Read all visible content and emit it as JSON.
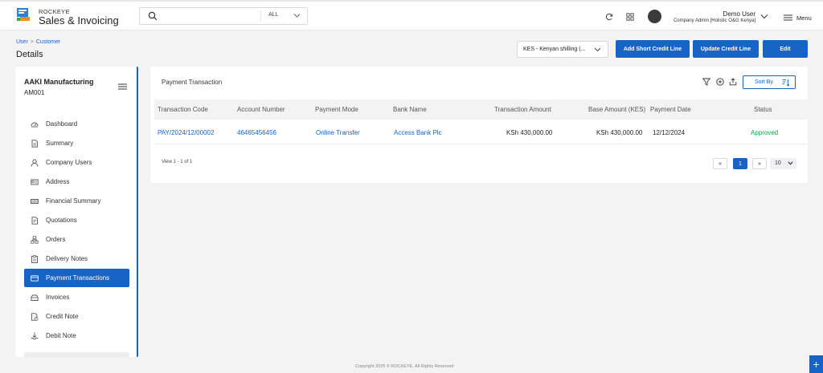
{
  "app": {
    "brand_small": "ROCKEYE",
    "brand_name": "Sales & Invoicing"
  },
  "search": {
    "value": "",
    "filter": "ALL"
  },
  "user": {
    "name": "Demo User",
    "role": "Company Admin [Holistic O&G Kenya]"
  },
  "menu_label": "Menu",
  "breadcrumb": {
    "items": [
      "User",
      "Customer"
    ],
    "separator": ">"
  },
  "page_title": "Details",
  "currency_select": "KES - Kenyan shilling (...",
  "actions": {
    "add_short_credit_line": "Add Short Credit Line",
    "update_credit_line": "Update Credit Line",
    "edit": "Edit"
  },
  "sidebar": {
    "company_name": "AAKI Manufacturing",
    "company_code": "AM001",
    "items": [
      {
        "label": "Dashboard",
        "icon": "dashboard-icon"
      },
      {
        "label": "Summary",
        "icon": "document-icon"
      },
      {
        "label": "Company Users",
        "icon": "user-icon"
      },
      {
        "label": "Address",
        "icon": "address-card-icon"
      },
      {
        "label": "Financial Summary",
        "icon": "money-icon"
      },
      {
        "label": "Quotations",
        "icon": "quotation-icon"
      },
      {
        "label": "Orders",
        "icon": "orders-icon"
      },
      {
        "label": "Delivery Notes",
        "icon": "clipboard-icon"
      },
      {
        "label": "Payment Transactions",
        "icon": "credit-card-icon",
        "active": true
      },
      {
        "label": "Invoices",
        "icon": "invoice-icon"
      },
      {
        "label": "Credit Note",
        "icon": "credit-note-icon"
      },
      {
        "label": "Debit Note",
        "icon": "debit-note-icon"
      }
    ]
  },
  "card": {
    "title": "Payment Transaction",
    "sort_label": "Sort By",
    "columns": [
      "Transaction Code",
      "Account Number",
      "Payment Mode",
      "Bank Name",
      "Transaction Amount",
      "Base Amount (KES)",
      "Payment Date",
      "Status"
    ],
    "rows": [
      {
        "transaction_code": "PAY/2024/12/00002",
        "account_number": "46465456456",
        "payment_mode": "Online Transfer",
        "bank_name": "Access Bank Plc",
        "transaction_amount": "KSh 430,000.00",
        "base_amount": "KSh 430,000.00",
        "payment_date": "12/12/2024",
        "status": "Approved"
      }
    ],
    "view_count": "View 1 - 1 of 1",
    "pagination": {
      "prev": "«",
      "current": "1",
      "next": "»",
      "page_size": "10"
    }
  },
  "footer": "Copyright 2025 © ROCKEYE. All Rights Reserved",
  "fab_label": "+",
  "colors": {
    "primary": "#1763c6",
    "approved": "#18a04a",
    "background": "#f3f3f4"
  }
}
